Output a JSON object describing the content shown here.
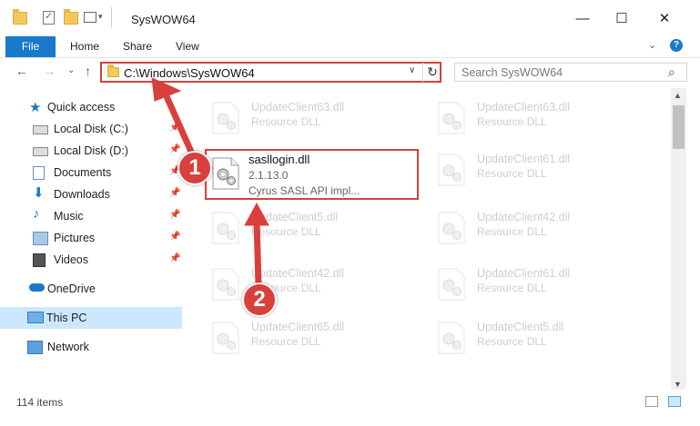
{
  "window": {
    "title": "SysWOW64",
    "controls": {
      "minimize": "—",
      "maximize": "☐",
      "close": "✕"
    }
  },
  "ribbon": {
    "tabs": [
      {
        "label": "File",
        "active": true
      },
      {
        "label": "Home"
      },
      {
        "label": "Share"
      },
      {
        "label": "View"
      }
    ],
    "chevron": "⌄",
    "help": "?"
  },
  "address_bar": {
    "path": "C:\\Windows\\SysWOW64",
    "refresh": "↻",
    "dropdown": "∨"
  },
  "search": {
    "placeholder": "Search SysWOW64",
    "icon": "search-icon"
  },
  "navigation": {
    "back": "←",
    "forward": "→",
    "recent": "⌄",
    "up": "↑"
  },
  "sidebar": {
    "quick_access": {
      "label": "Quick access",
      "icon": "star-icon"
    },
    "items": [
      {
        "label": "Local Disk (C:)",
        "icon": "drive-icon",
        "pinned": true
      },
      {
        "label": "Local Disk (D:)",
        "icon": "drive-icon",
        "pinned": true
      },
      {
        "label": "Documents",
        "icon": "documents-icon",
        "pinned": true
      },
      {
        "label": "Downloads",
        "icon": "downloads-icon",
        "pinned": true
      },
      {
        "label": "Music",
        "icon": "music-icon",
        "pinned": true
      },
      {
        "label": "Pictures",
        "icon": "pictures-icon",
        "pinned": true
      },
      {
        "label": "Videos",
        "icon": "videos-icon",
        "pinned": true
      }
    ],
    "onedrive": {
      "label": "OneDrive",
      "icon": "cloud-icon"
    },
    "this_pc": {
      "label": "This PC",
      "icon": "computer-icon",
      "selected": true
    },
    "network": {
      "label": "Network",
      "icon": "network-icon"
    }
  },
  "files": {
    "faded": [
      {
        "name": "UpdateClient63.dll",
        "type": "Resource DLL"
      },
      {
        "name": "UpdateClient63.dll",
        "type": "Resource DLL"
      },
      {
        "name": "UpdateClient61.dll",
        "type": "Resource DLL"
      },
      {
        "name": "UpdateClient5.dll",
        "type": "Resource DLL"
      },
      {
        "name": "UpdateClient42.dll",
        "type": "Resource DLL"
      },
      {
        "name": "UpdateClient42.dll",
        "type": "Resource DLL"
      },
      {
        "name": "UpdateClient61.dll",
        "type": "Resource DLL"
      },
      {
        "name": "UpdateClient65.dll",
        "type": "Resource DLL"
      },
      {
        "name": "UpdateClient5.dll",
        "type": "Resource DLL"
      }
    ],
    "selected": {
      "name": "sasllogin.dll",
      "version": "2.1.13.0",
      "description": "Cyrus SASL API impl..."
    }
  },
  "status_bar": {
    "item_count": "114 items"
  },
  "annotations": {
    "step1": "1",
    "step2": "2",
    "accent": "#d9403b"
  }
}
